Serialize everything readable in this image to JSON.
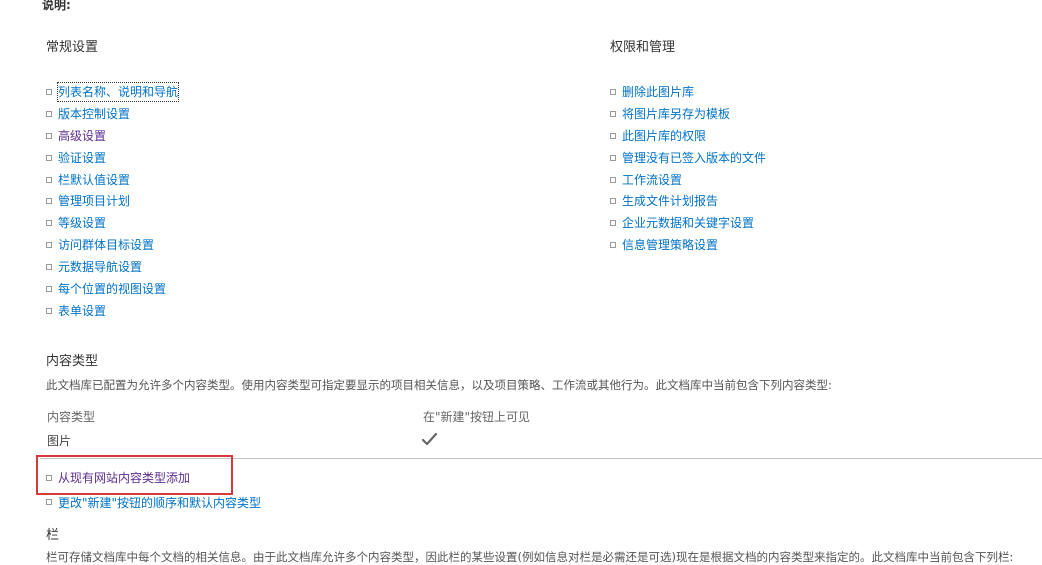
{
  "description_label": "说明:",
  "general_settings": {
    "heading": "常规设置",
    "links": [
      {
        "label": "列表名称、说明和导航"
      },
      {
        "label": "版本控制设置"
      },
      {
        "label": "高级设置"
      },
      {
        "label": "验证设置"
      },
      {
        "label": "栏默认值设置"
      },
      {
        "label": "管理项目计划"
      },
      {
        "label": "等级设置"
      },
      {
        "label": "访问群体目标设置"
      },
      {
        "label": "元数据导航设置"
      },
      {
        "label": "每个位置的视图设置"
      },
      {
        "label": "表单设置"
      }
    ]
  },
  "permissions_management": {
    "heading": "权限和管理",
    "links": [
      {
        "label": "删除此图片库"
      },
      {
        "label": "将图片库另存为模板"
      },
      {
        "label": "此图片库的权限"
      },
      {
        "label": "管理没有已签入版本的文件"
      },
      {
        "label": "工作流设置"
      },
      {
        "label": "生成文件计划报告"
      },
      {
        "label": "企业元数据和关键字设置"
      },
      {
        "label": "信息管理策略设置"
      }
    ]
  },
  "content_types": {
    "heading": "内容类型",
    "intro": "此文档库已配置为允许多个内容类型。使用内容类型可指定要显示的项目相关信息，以及项目策略、工作流或其他行为。此文档库中当前包含下列内容类型:",
    "col_type": "内容类型",
    "col_visible": "在\"新建\"按钮上可见",
    "rows": [
      {
        "name": "图片",
        "visible_icon": "checkmark-icon"
      }
    ],
    "links": [
      {
        "label": "从现有网站内容类型添加"
      },
      {
        "label": "更改\"新建\"按钮的顺序和默认内容类型"
      }
    ]
  },
  "columns": {
    "heading": "栏",
    "desc": "栏可存储文档库中每个文档的相关信息。由于此文档库允许多个内容类型，因此栏的某些设置(例如信息对栏是必需还是可选)现在是根据文档的内容类型来指定的。此文档库中当前包含下列栏:"
  },
  "colors": {
    "link": "#0072c6",
    "visited_link": "#5c2d91",
    "highlight": "#d9393a"
  }
}
